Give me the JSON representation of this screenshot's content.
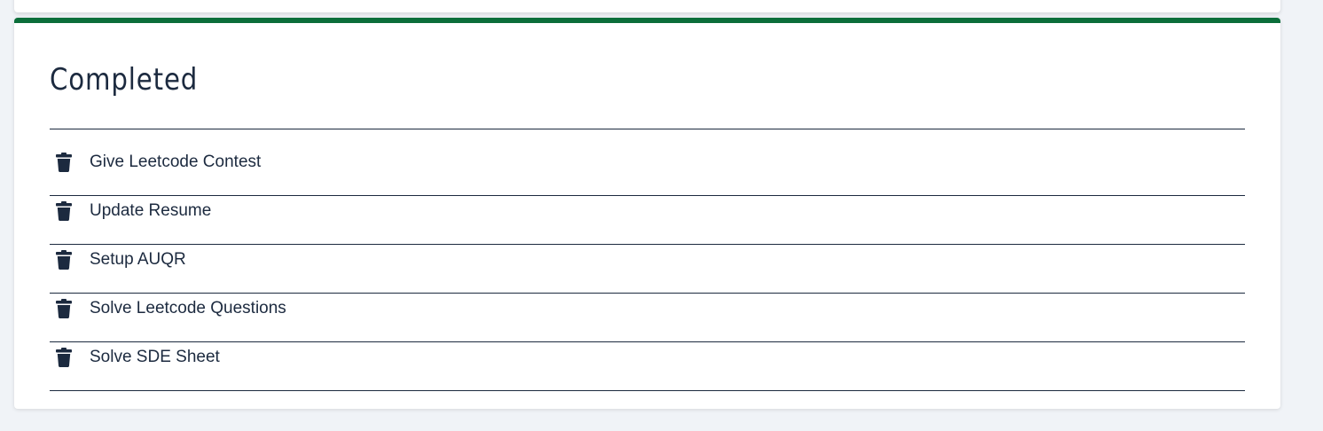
{
  "completed_section": {
    "title": "Completed",
    "tasks": [
      {
        "label": "Give Leetcode Contest",
        "icon": "trash-icon"
      },
      {
        "label": "Update Resume",
        "icon": "trash-icon"
      },
      {
        "label": "Setup AUQR",
        "icon": "trash-icon"
      },
      {
        "label": "Solve Leetcode Questions",
        "icon": "trash-icon"
      },
      {
        "label": "Solve SDE Sheet",
        "icon": "trash-icon"
      }
    ]
  },
  "colors": {
    "accent": "#0b6e3a",
    "text": "#1c2a3f",
    "background": "#f0f3f7",
    "card": "#ffffff"
  }
}
